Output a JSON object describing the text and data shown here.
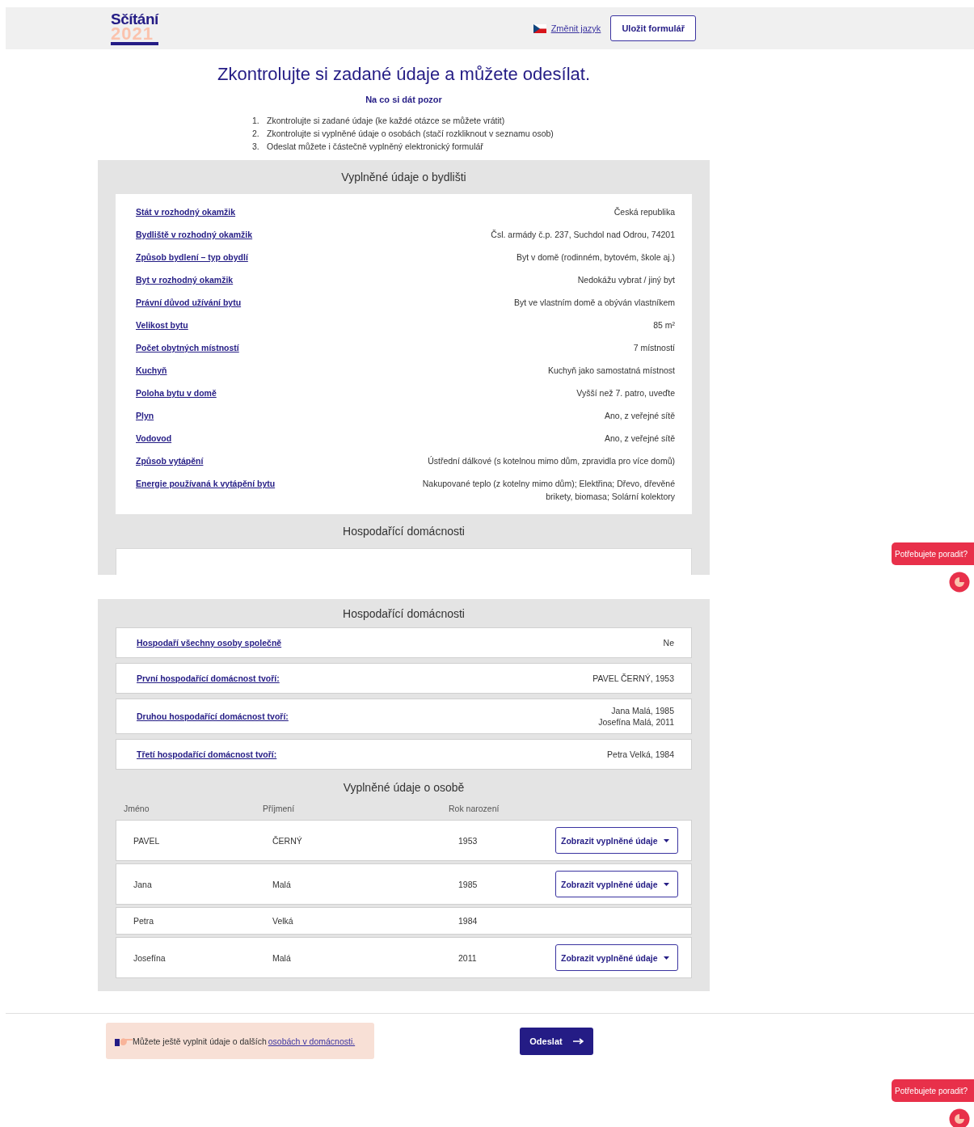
{
  "header": {
    "logo_word": "Sčítání",
    "logo_year": "2021",
    "language_link": "Změnit jazyk",
    "save_button": "Uložit formulář"
  },
  "title": "Zkontrolujte si zadané údaje a můžete odesílat.",
  "notice": {
    "heading": "Na co si dát pozor",
    "items": [
      {
        "number": "1.",
        "text": "Zkontrolujte si zadané údaje (ke každé otázce se můžete vrátit)"
      },
      {
        "number": "2.",
        "text": "Zkontrolujte si vyplněné údaje o osobách (stačí rozkliknout v seznamu osob)"
      },
      {
        "number": "3.",
        "text": "Odeslat můžete i částečně vyplněný elektronický formulář"
      }
    ]
  },
  "dwelling": {
    "heading": "Vyplněné údaje o bydlišti",
    "rows": [
      {
        "label": "Stát v rozhodný okamžik",
        "value": "Česká republika"
      },
      {
        "label": "Bydliště v rozhodný okamžik",
        "value": "Čsl. armády č.p. 237, Suchdol nad Odrou, 74201"
      },
      {
        "label": "Způsob bydlení – typ obydlí",
        "value": "Byt v domě (rodinném, bytovém, škole aj.)"
      },
      {
        "label": "Byt v rozhodný okamžik",
        "value": "Nedokážu vybrat / jiný byt"
      },
      {
        "label": "Právní důvod užívání bytu",
        "value": "Byt ve vlastním domě a obýván vlastníkem"
      },
      {
        "label": "Velikost bytu",
        "value": "85 m²"
      },
      {
        "label": "Počet obytných místností",
        "value": "7 místností"
      },
      {
        "label": "Kuchyň",
        "value": "Kuchyň jako samostatná místnost"
      },
      {
        "label": "Poloha bytu v domě",
        "value": "Vyšší než 7. patro, uveďte"
      },
      {
        "label": "Plyn",
        "value": "Ano, z veřejné sítě"
      },
      {
        "label": "Vodovod",
        "value": "Ano, z veřejné sítě"
      },
      {
        "label": "Způsob vytápění",
        "value": "Ústřední dálkové (s kotelnou mimo dům, zpravidla pro více domů)"
      },
      {
        "label": "Energie používaná k vytápění bytu",
        "value": "Nakupované teplo (z kotelny mimo dům); Elektřina; Dřevo, dřevěné brikety, biomasa; Solární kolektory"
      }
    ],
    "next_heading": "Hospodařící domácnosti"
  },
  "households": {
    "heading": "Hospodařící domácnosti",
    "rows": [
      {
        "label": "Hospodaří všechny osoby společně",
        "values": [
          "Ne"
        ]
      },
      {
        "label": "První hospodařící domácnost tvoří:",
        "values": [
          "PAVEL ČERNÝ, 1953"
        ]
      },
      {
        "label": "Druhou hospodařící domácnost tvoří:",
        "values": [
          "Jana Malá, 1985",
          "Josefína Malá, 2011"
        ]
      },
      {
        "label": "Třetí hospodařící domácnost tvoří:",
        "values": [
          "Petra Velká, 1984"
        ]
      }
    ]
  },
  "persons": {
    "heading": "Vyplněné údaje o osobě",
    "columns": [
      "Jméno",
      "Příjmení",
      "Rok narození"
    ],
    "rows": [
      {
        "first_name": "PAVEL",
        "last_name": "ČERNÝ",
        "year": "1953",
        "button": "Zobrazit vyplněné údaje"
      },
      {
        "first_name": "Jana",
        "last_name": "Malá",
        "year": "1985",
        "button": "Zobrazit vyplněné údaje"
      },
      {
        "first_name": "Petra",
        "last_name": "Velká",
        "year": "1984"
      },
      {
        "first_name": "Josefína",
        "last_name": "Malá",
        "year": "2011",
        "button": "Zobrazit vyplněné údaje"
      }
    ]
  },
  "footer": {
    "note": "Můžete ještě vyplnit údaje o dalších",
    "note_link": "osobách v domácnosti.",
    "submit_button": "Odeslat"
  },
  "help_widgets": [
    {
      "label": "Potřebujete poradit?"
    },
    {
      "label": "Potřebujete poradit?"
    }
  ]
}
